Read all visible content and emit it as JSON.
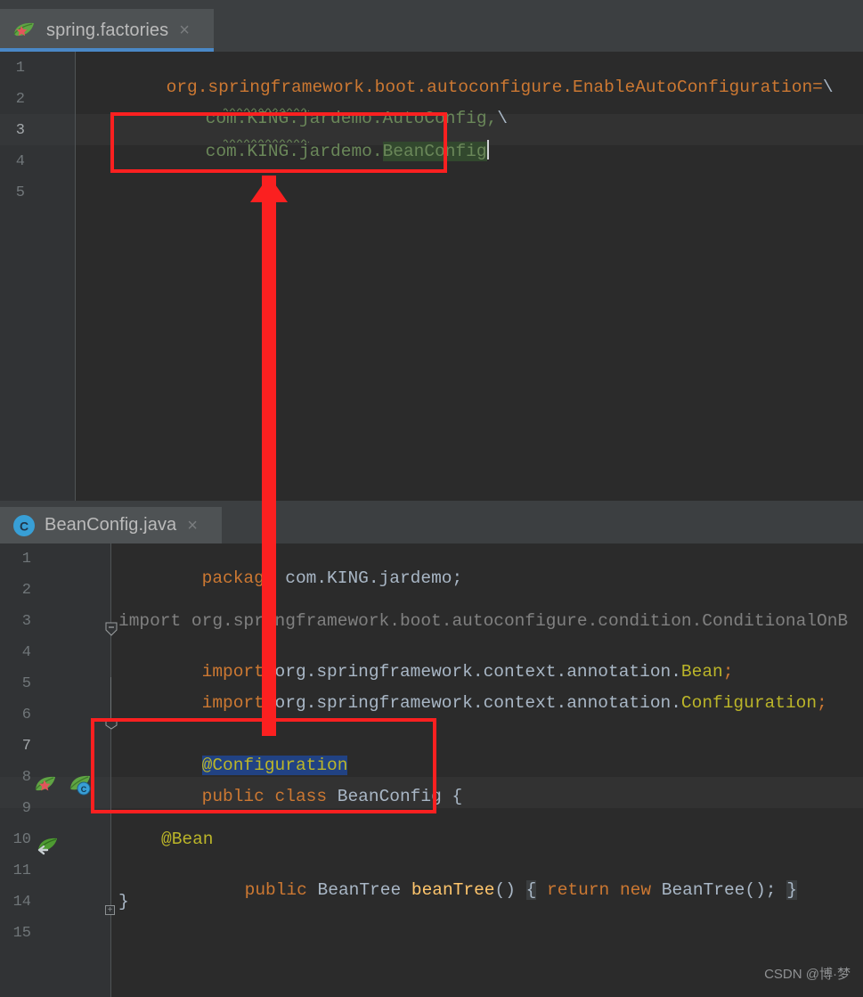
{
  "window": {
    "theme": "darcula",
    "accent_blue": "#4a88c7",
    "annotation_red": "#fb2020",
    "editor_bg": "#2b2b2b",
    "gutter_bg": "#313335",
    "chrome_bg": "#3c3f41"
  },
  "watermark": {
    "text": "CSDN @博·梦"
  },
  "panes": [
    {
      "id": "spring-factories-pane",
      "tab": {
        "label": "spring.factories",
        "icon": "spring-leaf-icon",
        "close_label": "×",
        "active": true
      },
      "lines": [
        {
          "num": "1"
        },
        {
          "num": "2"
        },
        {
          "num": "3"
        },
        {
          "num": "4"
        },
        {
          "num": "5"
        }
      ],
      "code": {
        "line1_part1": "org.springframework.boot.autoconfigure.EnableAutoConfiguration=",
        "line1_part2": "\\",
        "line2_text": "com.KING.jardemo.AutoConfig,",
        "line2_slash": "\\",
        "line3_prefix": "com.KING.jardemo.",
        "line3_selected": "BeanConfig"
      }
    },
    {
      "id": "beanconfig-java-pane",
      "tab": {
        "label": "BeanConfig.java",
        "icon": "java-class-icon",
        "close_label": "×",
        "active": false
      },
      "lines": [
        {
          "num": "1"
        },
        {
          "num": "2"
        },
        {
          "num": "3"
        },
        {
          "num": "4"
        },
        {
          "num": "5"
        },
        {
          "num": "6"
        },
        {
          "num": "7"
        },
        {
          "num": "8"
        },
        {
          "num": "9"
        },
        {
          "num": "10"
        },
        {
          "num": "11"
        },
        {
          "num": "14"
        },
        {
          "num": "15"
        }
      ],
      "code": {
        "l1_kw": "package",
        "l1_rest": " com.KING.jardemo;",
        "l3_import": "import org.springframework.boot.autoconfigure.condition.ConditionalOnB",
        "l4_kw": "import",
        "l4_path": " org.springframework.context.annotation.",
        "l4_cls": "Bean",
        "l4_semi": ";",
        "l5_kw": "import",
        "l5_path": " org.springframework.context.annotation.",
        "l5_cls": "Configuration",
        "l5_semi": ";",
        "l7_annotation": "@Configuration",
        "l8_kw1": "public",
        "l8_kw2": "class",
        "l8_name": "BeanConfig",
        "l8_brace": "{",
        "l10_annotation": "@Bean",
        "l11_kw": "public",
        "l11_type": "BeanTree",
        "l11_method": "beanTree",
        "l11_parens": "()",
        "l11_fold_open": "{",
        "l11_fold_kw1": "return",
        "l11_fold_kw2": "new",
        "l11_fold_type": "BeanTree();",
        "l11_fold_close": "}",
        "l14_brace": "}"
      },
      "gutter_icons": [
        {
          "name": "spring-bean-gutter-icon",
          "line": "8"
        },
        {
          "name": "spring-config-gutter-icon",
          "line": "8"
        },
        {
          "name": "spring-bean-navigate-icon",
          "line": "10"
        }
      ]
    }
  ],
  "annotations": {
    "box_top": {
      "name": "highlight-box-beanconfig-entry"
    },
    "box_bottom": {
      "name": "highlight-box-configuration-class"
    },
    "arrow": {
      "name": "red-up-arrow",
      "direction": "up"
    }
  }
}
